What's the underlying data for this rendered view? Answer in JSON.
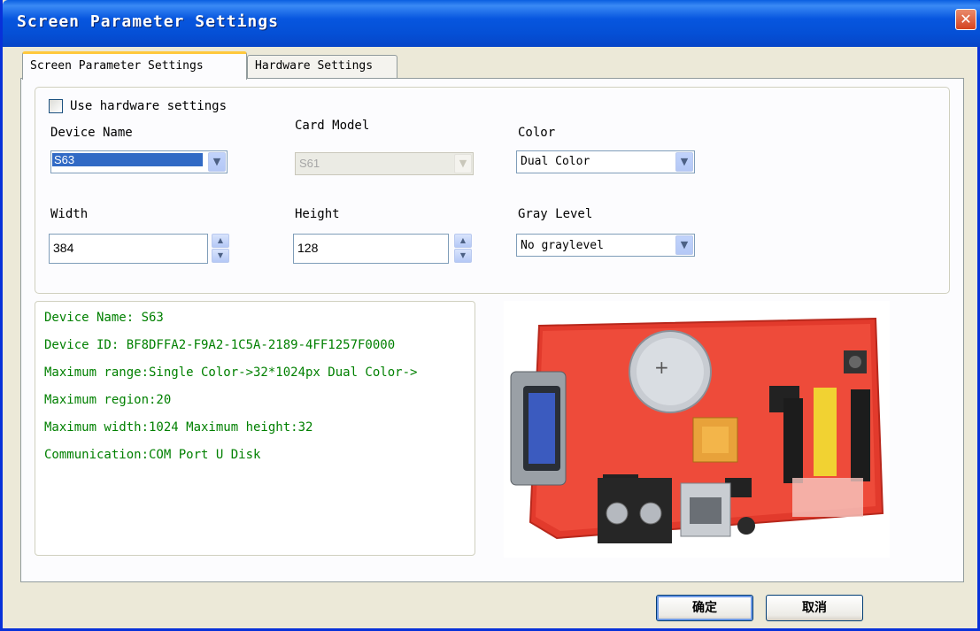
{
  "window": {
    "title": "Screen Parameter Settings",
    "close_glyph": "✕"
  },
  "tabs": [
    {
      "label": "Screen Parameter Settings",
      "active": true
    },
    {
      "label": "Hardware Settings",
      "active": false
    }
  ],
  "form": {
    "use_hardware_settings": {
      "label": "Use hardware settings",
      "checked": false
    },
    "device_name": {
      "label": "Device Name",
      "value": "S63"
    },
    "card_model": {
      "label": "Card Model",
      "value": "S61",
      "disabled": true
    },
    "color": {
      "label": "Color",
      "value": "Dual Color"
    },
    "width": {
      "label": "Width",
      "value": "384"
    },
    "height": {
      "label": "Height",
      "value": "128"
    },
    "gray_level": {
      "label": "Gray Level",
      "value": "No graylevel"
    }
  },
  "info": {
    "lines": [
      "Device Name: S63",
      "Device ID:  BF8DFFA2-F9A2-1C5A-2189-4FF1257F0000",
      "Maximum range:Single Color->32*1024px  Dual Color->",
      "Maximum region:20",
      "Maximum width:1024 Maximum height:32",
      "Communication:COM Port  U Disk"
    ],
    "text_color": "#008000"
  },
  "buttons": {
    "ok": "确定",
    "cancel": "取消"
  },
  "icons": {
    "dropdown": "chevron-down-icon",
    "spin": "spinner-icon",
    "close": "close-icon"
  },
  "colors": {
    "titlebar": "#0756df",
    "selection": "#316ac5",
    "info_text": "#008000"
  }
}
